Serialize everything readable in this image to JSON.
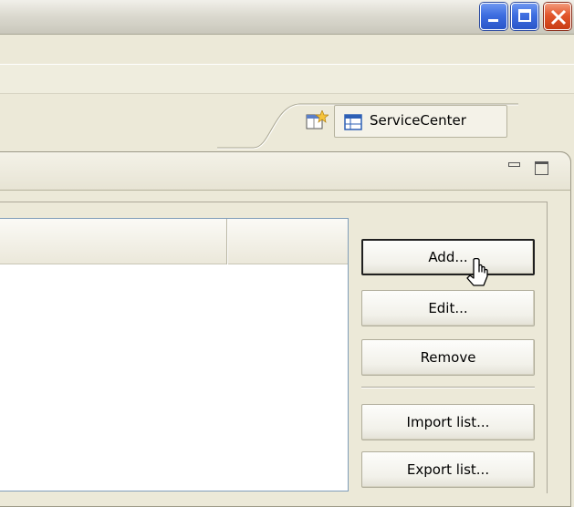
{
  "window": {
    "controls": [
      {
        "name": "minimize",
        "icon": "minimize-icon"
      },
      {
        "name": "maximize",
        "icon": "maximize-icon"
      },
      {
        "name": "close",
        "icon": "close-icon"
      }
    ]
  },
  "perspective": {
    "open_icon": "open-perspective-icon",
    "active_label": "ServiceCenter",
    "active_icon": "table-grid-icon"
  },
  "view": {
    "toolbar_icons": [
      "minimize-view-icon",
      "maximize-view-icon"
    ]
  },
  "table": {
    "columns": [
      "",
      ""
    ],
    "rows": []
  },
  "buttons": {
    "add": "Add...",
    "edit": "Edit...",
    "remove": "Remove",
    "import": "Import list...",
    "export": "Export list..."
  },
  "colors": {
    "close_button": "#e2562c",
    "window_button": "#3d6de0",
    "background": "#ece9d8"
  }
}
